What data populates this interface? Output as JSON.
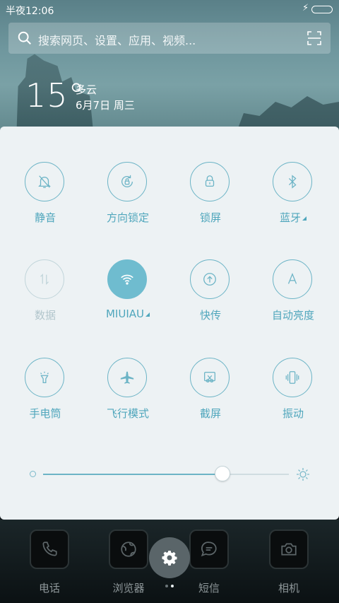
{
  "status_bar": {
    "time": "半夜12:06"
  },
  "search": {
    "placeholder": "搜索网页、设置、应用、视频..."
  },
  "weather": {
    "temperature": "15°",
    "condition": "多云",
    "date": "6月7日 周三"
  },
  "toggles": [
    {
      "label": "静音",
      "icon": "silent-bell-icon",
      "state": "off"
    },
    {
      "label": "方向锁定",
      "icon": "rotation-lock-icon",
      "state": "off"
    },
    {
      "label": "锁屏",
      "icon": "lock-icon",
      "state": "off"
    },
    {
      "label": "蓝牙",
      "icon": "bluetooth-icon",
      "state": "off",
      "has_menu": true
    },
    {
      "label": "数据",
      "icon": "mobile-data-icon",
      "state": "disabled"
    },
    {
      "label": "MIUIAU",
      "icon": "wifi-icon",
      "state": "on",
      "has_menu": true
    },
    {
      "label": "快传",
      "icon": "quick-transfer-icon",
      "state": "off"
    },
    {
      "label": "自动亮度",
      "icon": "auto-brightness-icon",
      "state": "off"
    },
    {
      "label": "手电筒",
      "icon": "flashlight-icon",
      "state": "off"
    },
    {
      "label": "飞行模式",
      "icon": "airplane-icon",
      "state": "off"
    },
    {
      "label": "截屏",
      "icon": "screenshot-icon",
      "state": "off"
    },
    {
      "label": "振动",
      "icon": "vibrate-icon",
      "state": "off"
    }
  ],
  "brightness": {
    "level": 0.73
  },
  "dock": [
    {
      "label": "电话",
      "icon": "phone-icon"
    },
    {
      "label": "浏览器",
      "icon": "browser-icon"
    },
    {
      "label": "短信",
      "icon": "message-icon"
    },
    {
      "label": "相机",
      "icon": "camera-icon"
    }
  ],
  "page_indicator": {
    "total": 2,
    "current": 2
  },
  "colors": {
    "accent": "#6fbccf",
    "label": "#4fa6bc",
    "panel": "#edf2f4",
    "disabled": "#b2c6cc"
  }
}
